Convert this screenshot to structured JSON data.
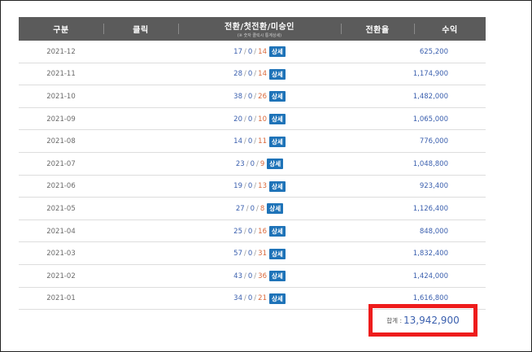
{
  "header": {
    "col_category": "구분",
    "col_click": "클릭",
    "col_conversion": "전환/첫전환/미승인",
    "col_conversion_note": "(※ 숫자 클릭시 통계상세)",
    "col_rate": "전환율",
    "col_revenue": "수익"
  },
  "detail_label": "상세",
  "rows": [
    {
      "month": "2021-12",
      "conv": "17",
      "first": "0",
      "pending": "14",
      "revenue": "625,200"
    },
    {
      "month": "2021-11",
      "conv": "28",
      "first": "0",
      "pending": "14",
      "revenue": "1,174,900"
    },
    {
      "month": "2021-10",
      "conv": "38",
      "first": "0",
      "pending": "26",
      "revenue": "1,482,000"
    },
    {
      "month": "2021-09",
      "conv": "20",
      "first": "0",
      "pending": "10",
      "revenue": "1,065,000"
    },
    {
      "month": "2021-08",
      "conv": "14",
      "first": "0",
      "pending": "11",
      "revenue": "776,000"
    },
    {
      "month": "2021-07",
      "conv": "23",
      "first": "0",
      "pending": "9",
      "revenue": "1,048,800"
    },
    {
      "month": "2021-06",
      "conv": "19",
      "first": "0",
      "pending": "13",
      "revenue": "923,400"
    },
    {
      "month": "2021-05",
      "conv": "27",
      "first": "0",
      "pending": "8",
      "revenue": "1,126,400"
    },
    {
      "month": "2021-04",
      "conv": "25",
      "first": "0",
      "pending": "16",
      "revenue": "848,000"
    },
    {
      "month": "2021-03",
      "conv": "57",
      "first": "0",
      "pending": "31",
      "revenue": "1,832,400"
    },
    {
      "month": "2021-02",
      "conv": "43",
      "first": "0",
      "pending": "36",
      "revenue": "1,424,000"
    },
    {
      "month": "2021-01",
      "conv": "34",
      "first": "0",
      "pending": "21",
      "revenue": "1,616,800"
    }
  ],
  "total": {
    "label": "합계 :",
    "value": "13,942,900"
  },
  "colors": {
    "header_bg": "#5b5b5b",
    "link_blue": "#3a5fae",
    "pending_orange": "#d9683a",
    "button_blue": "#1e73b8",
    "highlight_red": "#ee1c1c"
  }
}
